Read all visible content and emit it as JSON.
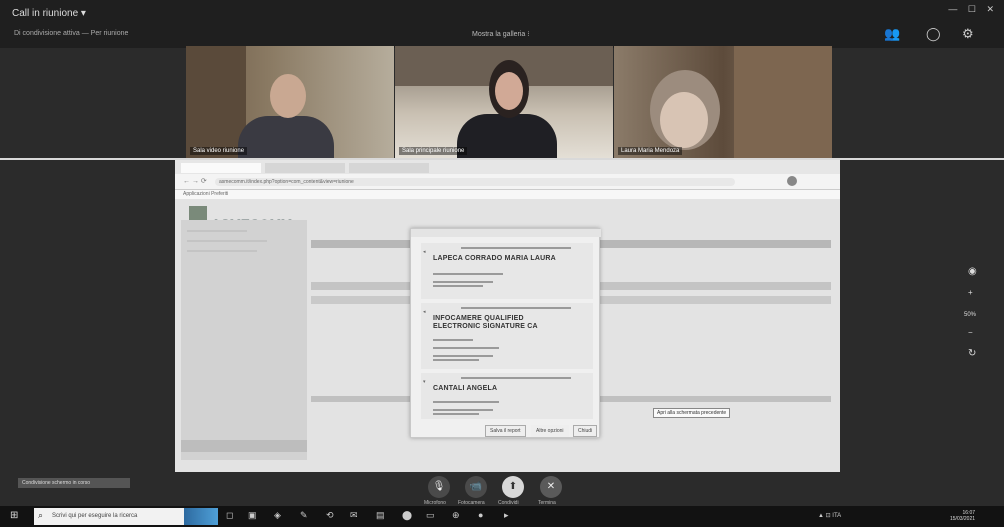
{
  "app": {
    "title": "Call in riunione ▾",
    "subtitle": "Di condivisione attiva — Per riunione",
    "view_toggle": "Mostra la galleria ⁝",
    "window_controls": "— ☐ ✕"
  },
  "participants": [
    {
      "label": "Sala video riunione"
    },
    {
      "label": "Sala principale riunione"
    },
    {
      "label": "Laura Maria Mendoza"
    }
  ],
  "browser": {
    "url": "asmecomm.it/index.php?option=com_content&view=riunione",
    "bookmarks": "Applicazioni   Preferiti"
  },
  "site": {
    "logo": "ASMECOMM"
  },
  "dialog": {
    "signers": [
      {
        "name": "LAPECA CORRADO MARIA LAURA"
      },
      {
        "name": "INFOCAMERE QUALIFIED ELECTRONIC SIGNATURE CA"
      },
      {
        "name": "CANTALI ANGELA"
      }
    ],
    "buttons": [
      "Salva il report",
      "Altre opzioni",
      "Chiudi"
    ]
  },
  "tooltip": "Apri alla schermata precedente",
  "right_controls": {
    "zoom": "50%"
  },
  "call_controls": [
    {
      "label": "Microfono",
      "icon": "microphone-icon",
      "glyph": "🎙"
    },
    {
      "label": "Fotocamera",
      "icon": "camera-icon",
      "glyph": "📹"
    },
    {
      "label": "Condividi",
      "icon": "share-screen-icon",
      "glyph": "⬆"
    },
    {
      "label": "Termina",
      "icon": "end-call-icon",
      "glyph": "✕"
    }
  ],
  "sharing_notice": "Condivisione schermo in corso",
  "taskbar": {
    "search_placeholder": "Scrivi qui per eseguire la ricerca",
    "tray": "▲  ⊡  ITA",
    "time": "16:07",
    "date": "15/03/2021"
  },
  "colors": {
    "meeting_bg": "#2b2b2b",
    "taskbar": "#121212"
  }
}
